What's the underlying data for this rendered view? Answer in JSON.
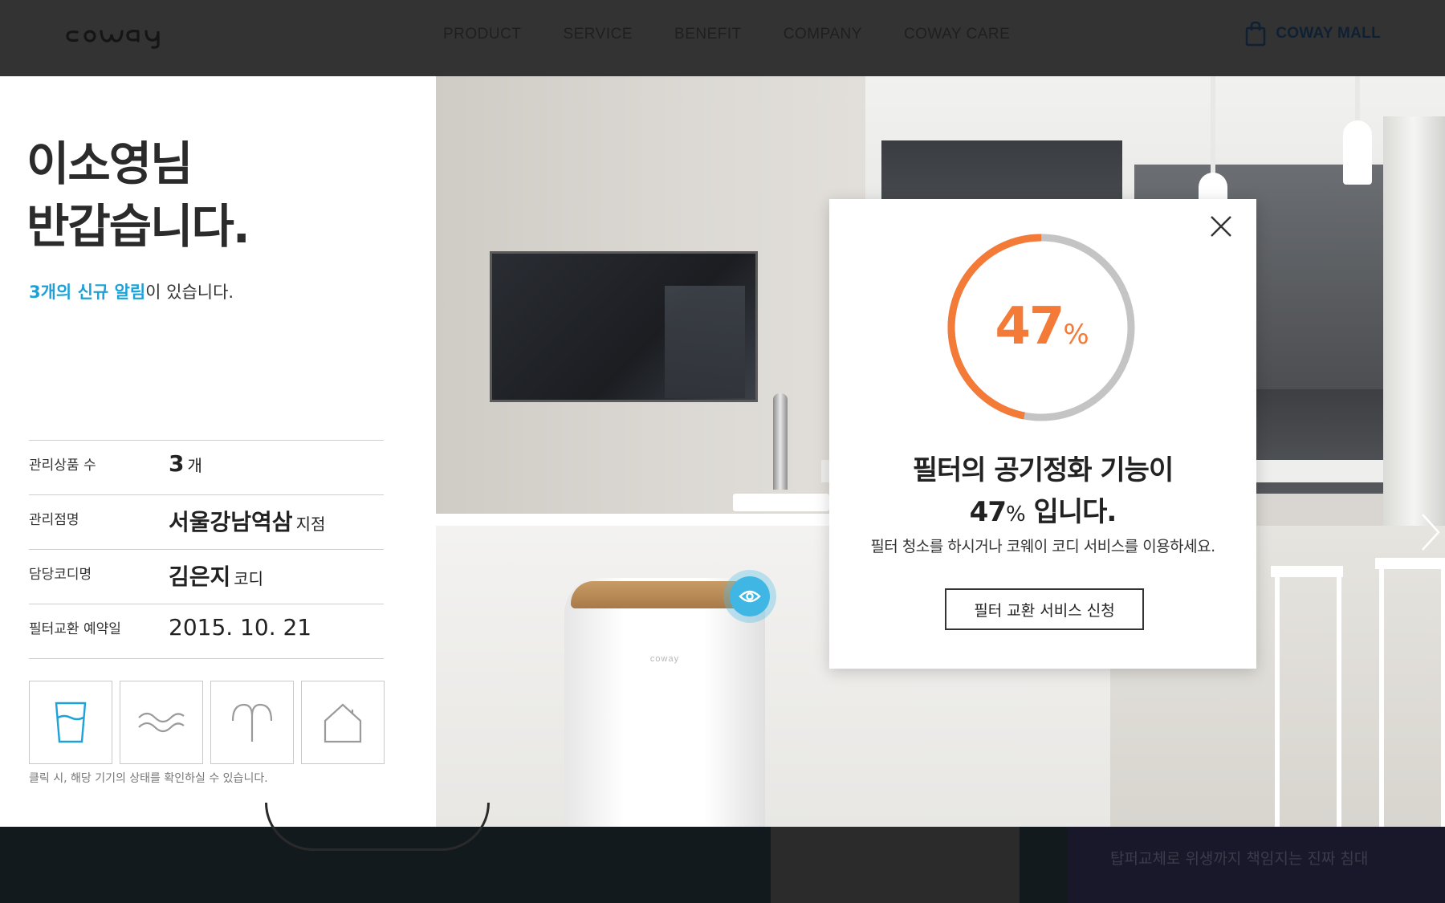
{
  "header": {
    "logo_text": "coway",
    "nav": [
      "PRODUCT",
      "SERVICE",
      "BENEFIT",
      "COMPANY",
      "COWAY CARE"
    ],
    "mall_label": "COWAY MALL",
    "mall_icon": "shopping-bag-icon"
  },
  "panel": {
    "greeting_line1": "이소영님",
    "greeting_line2": "반갑습니다.",
    "notice_highlight": "3개의 신규 알림",
    "notice_rest": "이 있습니다.",
    "info_rows": [
      {
        "label": "관리상품 수",
        "value": "3",
        "unit": "개"
      },
      {
        "label": "관리점명",
        "value": "서울강남역삼",
        "unit": "지점"
      },
      {
        "label": "담당코디명",
        "value": "김은지",
        "unit": "코디"
      },
      {
        "label": "필터교환 예약일",
        "value": "2015. 10. 21",
        "unit": ""
      }
    ],
    "device_icons": [
      "water-cup-icon",
      "air-wave-icon",
      "bidet-icon",
      "home-icon"
    ],
    "hint": "클릭 시, 해당 기기의 상태를 확인하실 수 있습니다."
  },
  "scene": {
    "purifier_brand": "coway"
  },
  "popup": {
    "gauge_value": "47",
    "gauge_unit": "%",
    "gauge_fraction": 0.47,
    "gauge_color": "#f37a37",
    "gauge_track_color": "#c4c4c4",
    "title_line1": "필터의 공기정화 기능이",
    "title_value": "47",
    "title_unit": "%",
    "title_rest": " 입니다.",
    "description": "필터 청소를 하시거나 코웨이 코디 서비스를 이용하세요.",
    "action_label": "필터 교환 서비스 신청"
  },
  "bottom": {
    "caption": "탑퍼교체로 위생까지 책임지는 진짜 침대"
  },
  "colors": {
    "accent_blue": "#1ca2d9",
    "accent_orange": "#f37a37",
    "header_bg": "#333333"
  }
}
